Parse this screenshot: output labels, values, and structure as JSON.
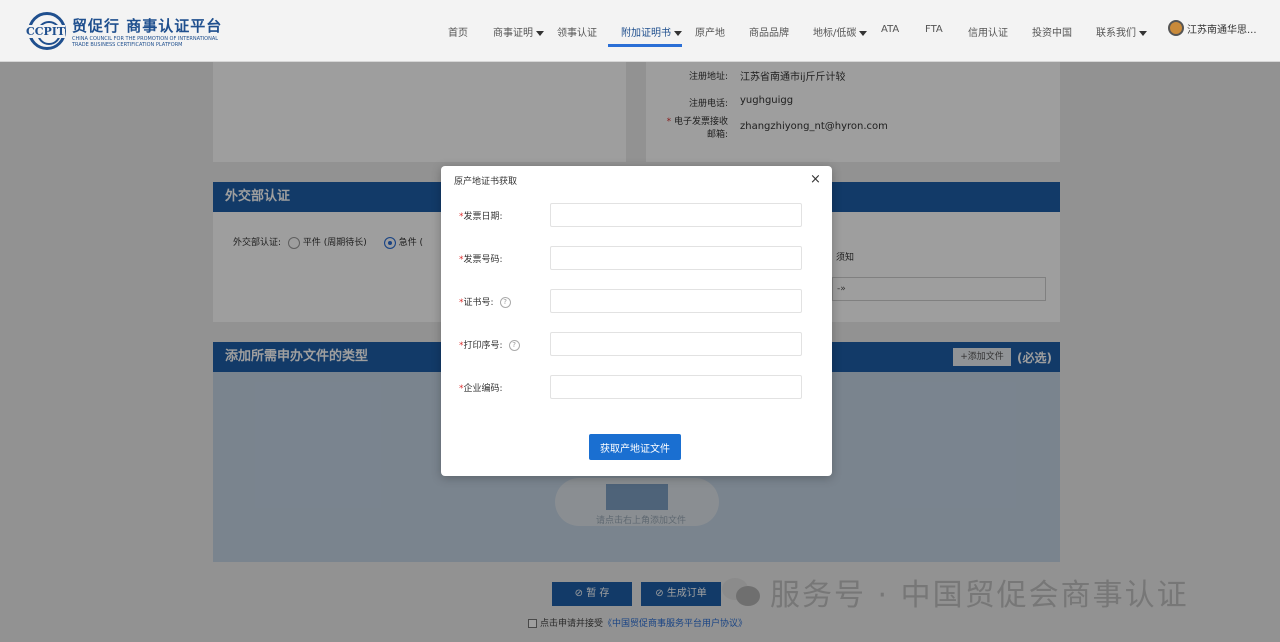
{
  "logo": {
    "brand": "CCPIT",
    "cn": "贸促行 商事认证平台",
    "en": "CHINA COUNCIL FOR THE PROMOTION OF INTERNATIONAL TRADE BUSINESS CERTIFICATION PLATFORM"
  },
  "nav": {
    "items": [
      {
        "label": "首页"
      },
      {
        "label": "商事证明"
      },
      {
        "label": "领事认证"
      },
      {
        "label": "附加证明书"
      },
      {
        "label": "原产地"
      },
      {
        "label": "商品品牌"
      },
      {
        "label": "地标/低碳"
      },
      {
        "label": "ATA"
      },
      {
        "label": "FTA"
      },
      {
        "label": "信用认证"
      },
      {
        "label": "投资中国"
      },
      {
        "label": "联系我们"
      }
    ],
    "user": "江苏南通华思..."
  },
  "company": {
    "reg_address_label": "注册地址:",
    "reg_address": "江苏省南通市ij斤斤计较",
    "reg_phone_label": "注册电话:",
    "reg_phone": "yughguigg",
    "email_label": "电子发票接收邮箱:",
    "email": "zhangzhiyong_nt@hyron.com"
  },
  "foreign_affairs": {
    "title": "外交部认证",
    "label": "外交部认证:",
    "option1": "平件 (周期待长)",
    "option2": "急件 (",
    "right_text": "须知",
    "right_input": "-»"
  },
  "docs": {
    "title": "添加所需申办文件的类型",
    "add_file": "+添加文件",
    "required": "(必选)",
    "upload_hint": "请点击右上角添加文件"
  },
  "actions": {
    "save": "暂 存",
    "generate": "生成订单",
    "agree_prefix": "点击申请并接受",
    "agree_link": "《中国贸促商事服务平台用户协议》"
  },
  "watermark": {
    "text": "服务号 · 中国贸促会商事认证"
  },
  "modal": {
    "title": "原产地证书获取",
    "close": "×",
    "fields": [
      {
        "label": "发票日期:",
        "value": ""
      },
      {
        "label": "发票号码:",
        "value": ""
      },
      {
        "label": "证书号:",
        "value": ""
      },
      {
        "label": "打印序号:",
        "value": ""
      },
      {
        "label": "企业编码:",
        "value": ""
      }
    ],
    "submit": "获取产地证文件"
  }
}
